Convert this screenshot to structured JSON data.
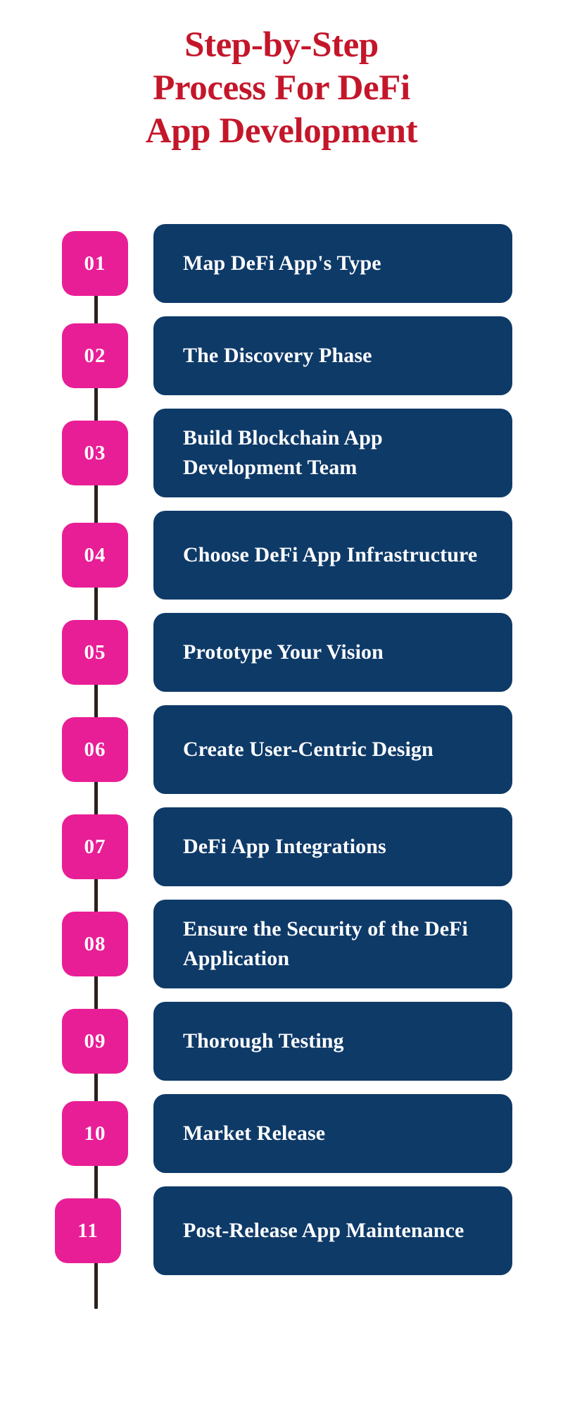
{
  "title": {
    "lines": [
      "Step-by-Step",
      "Process For DeFi",
      "App Development"
    ],
    "color": "#C4162A"
  },
  "theme": {
    "background": "#FFFFFF",
    "badge_color": "#E81E96",
    "card_color": "#0E3A68",
    "card_text_color": "#FFFFFF",
    "rail_color": "#2C211B",
    "title_color": "#C4162A"
  },
  "steps": [
    {
      "number": "01",
      "label": "Map DeFi App's Type"
    },
    {
      "number": "02",
      "label": "The Discovery Phase"
    },
    {
      "number": "03",
      "label": "Build Blockchain App Development Team"
    },
    {
      "number": "04",
      "label": "Choose DeFi App Infrastructure"
    },
    {
      "number": "05",
      "label": "Prototype Your Vision"
    },
    {
      "number": "06",
      "label": "Create User-Centric Design"
    },
    {
      "number": "07",
      "label": "DeFi App Integrations"
    },
    {
      "number": "08",
      "label": "Ensure the Security of the DeFi Application"
    },
    {
      "number": "09",
      "label": "Thorough Testing"
    },
    {
      "number": "10",
      "label": "Market Release"
    },
    {
      "number": "11",
      "label": "Post-Release App Maintenance"
    }
  ]
}
